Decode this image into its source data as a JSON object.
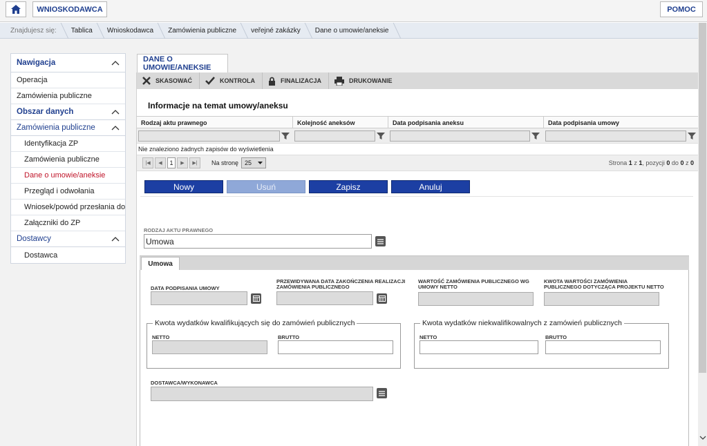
{
  "topbar": {
    "home_icon": "home-icon",
    "applicant_label": "WNIOSKODAWCA",
    "help_label": "POMOC"
  },
  "breadcrumb": {
    "prefix": "Znajdujesz się:",
    "items": [
      "Tablica",
      "Wnioskodawca",
      "Zamówienia publiczne",
      "veřejné zakázky",
      "Dane o umowie/aneksie"
    ]
  },
  "nav": {
    "header": "Nawigacja",
    "top_items": [
      "Operacja",
      "Zamówienia publiczne"
    ],
    "data_section": "Obszar danych",
    "public_orders_section": "Zamówienia publiczne",
    "public_orders_items": [
      "Identyfikacja ZP",
      "Zamówienia publiczne",
      "Dane o umowie/aneksie",
      "Przegląd i odwołania",
      "Wniosek/powód przesłania do UOKiK",
      "Załączniki do ZP"
    ],
    "suppliers_section": "Dostawcy",
    "suppliers_items": [
      "Dostawca"
    ]
  },
  "page": {
    "tab_title": "DANE O UMOWIE/ANEKSIE",
    "toolbar": {
      "cancel": "SKASOWAĆ",
      "check": "KONTROLA",
      "finalize": "FINALIZACJA",
      "print": "DRUKOWANIE"
    },
    "section_title": "Informacje na temat umowy/aneksu"
  },
  "grid": {
    "columns": [
      "Rodzaj aktu prawnego",
      "Kolejność aneksów",
      "Data podpisania aneksu",
      "Data podpisania umowy"
    ],
    "empty_message": "Nie znaleziono żadnych zapisów do wyświetlenia",
    "pager": {
      "page_number": "1",
      "per_page_label": "Na stronę",
      "per_page_value": "25",
      "info_page": "Strona",
      "info_current": "1",
      "info_of": "z",
      "info_total_pages": "1",
      "info_items": ", pozycji",
      "info_from": "0",
      "info_to_label": "do",
      "info_to": "0",
      "info_of2": "z",
      "info_total": "0"
    }
  },
  "actions": {
    "new": "Nowy",
    "delete": "Usuń",
    "save": "Zapisz",
    "cancel": "Anuluj"
  },
  "form": {
    "legal_act_label": "RODZAJ AKTU PRAWNEGO",
    "legal_act_value": "Umowa",
    "subtab": "Umowa",
    "contract_date_label": "DATA PODPISANIA UMOWY",
    "expected_end_label": "PRZEWIDYWANA DATA ZAKOŃCZENIA REALIZACJI ZAMÓWIENIA PUBLICZNEGO",
    "contract_value_label": "WARTOŚĆ ZAMÓWIENIA PUBLICZNEGO WG UMOWY NETTO",
    "project_value_label": "KWOTA WARTOŚCI ZAMÓWIENIA PUBLICZNEGO DOTYCZĄCA PROJEKTU NETTO",
    "eligible_legend": "Kwota wydatków kwalifikujących się do zamówień publicznych",
    "ineligible_legend": "Kwota wydatków niekwalifikowalnych z zamówień publicznych",
    "netto": "NETTO",
    "brutto": "BRUTTO",
    "supplier_label": "DOSTAWCA/WYKONAWCA"
  }
}
